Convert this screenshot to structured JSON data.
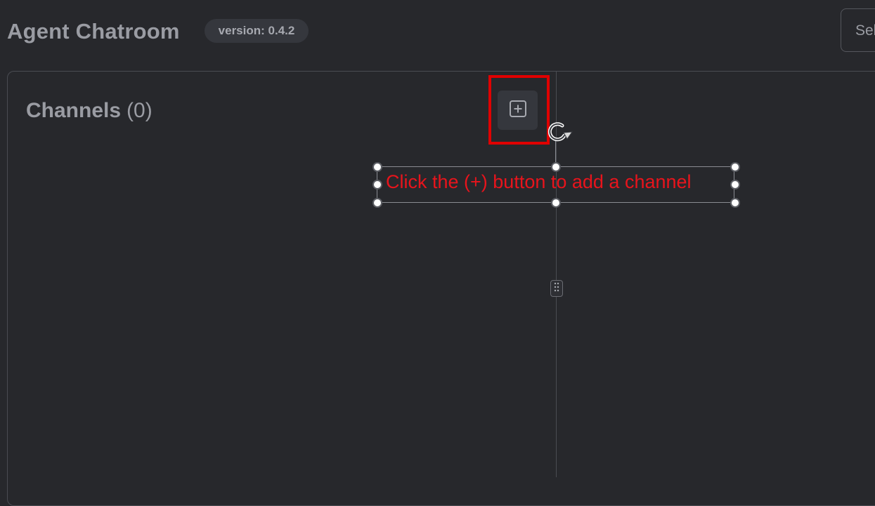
{
  "header": {
    "app_title": "Agent Chatroom",
    "version_label": "version: 0.4.2",
    "select_placeholder": "Sel"
  },
  "channels": {
    "heading": "Channels",
    "count": "(0)"
  },
  "annotation": {
    "text": "Click the (+) button to add a channel",
    "color": "#e8141c",
    "highlight_color": "#e00000"
  },
  "icons": {
    "add": "plus-square-icon",
    "rotate": "rotate-icon",
    "drag": "drag-handle-icon"
  }
}
